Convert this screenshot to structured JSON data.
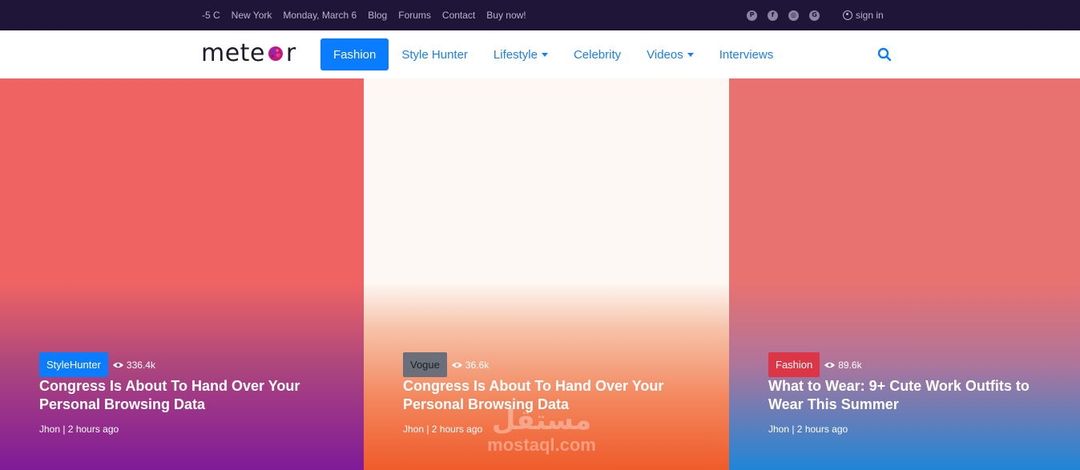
{
  "topbar": {
    "temperature": "-5 C",
    "city": "New York",
    "date": "Monday, March 6",
    "links": [
      "Blog",
      "Forums",
      "Contact",
      "Buy now!"
    ],
    "social_icons": [
      "pinterest-icon",
      "facebook-icon",
      "instagram-icon",
      "google-plus-icon"
    ],
    "sign_in": "sign in"
  },
  "navbar": {
    "logo_left": "mete",
    "logo_right": "r",
    "items": [
      {
        "label": "Fashion",
        "active": true,
        "dropdown": false
      },
      {
        "label": "Style Hunter",
        "active": false,
        "dropdown": false
      },
      {
        "label": "Lifestyle",
        "active": false,
        "dropdown": true
      },
      {
        "label": "Celebrity",
        "active": false,
        "dropdown": false
      },
      {
        "label": "Videos",
        "active": false,
        "dropdown": true
      },
      {
        "label": "Interviews",
        "active": false,
        "dropdown": false
      }
    ],
    "accent": "#0a7cff"
  },
  "cards": [
    {
      "category": "StyleHunter",
      "category_color": "#0a7cff",
      "views": "336.4k",
      "title": "Congress Is About To Hand Over Your Personal Browsing Data",
      "meta": "Jhon | 2 hours ago"
    },
    {
      "category": "Vogue",
      "category_color": "#6b6f7a",
      "views": "36.6k",
      "title": "Congress Is About To Hand Over Your Personal Browsing Data",
      "meta": "Jhon | 2 hours ago"
    },
    {
      "category": "Fashion",
      "category_color": "#dc3545",
      "views": "89.6k",
      "title": "What to Wear: 9+ Cute Work Outfits to Wear This Summer",
      "meta": "Jhon | 2 hours ago"
    }
  ],
  "watermark": {
    "arabic": "مستقل",
    "latin": "mostaql.com"
  }
}
